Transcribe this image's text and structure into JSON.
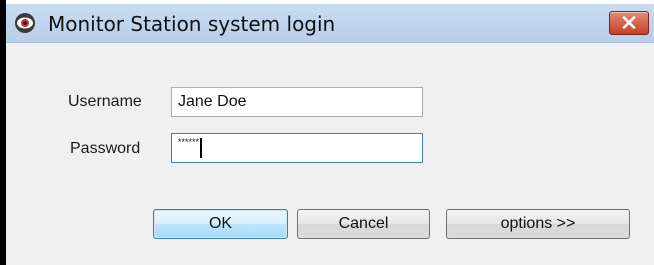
{
  "window": {
    "title": "Monitor Station system login",
    "icon": "eye-icon",
    "close_icon": "close-icon"
  },
  "form": {
    "username_label": "Username",
    "username_value": "Jane Doe",
    "password_label": "Password",
    "password_value": "******"
  },
  "buttons": {
    "ok": "OK",
    "cancel": "Cancel",
    "options": "options >>"
  },
  "colors": {
    "titlebar": "#c1d6ee",
    "close_button": "#c4402b",
    "dialog_background": "#f0f0f0",
    "default_button_border": "#3c7fb1"
  }
}
